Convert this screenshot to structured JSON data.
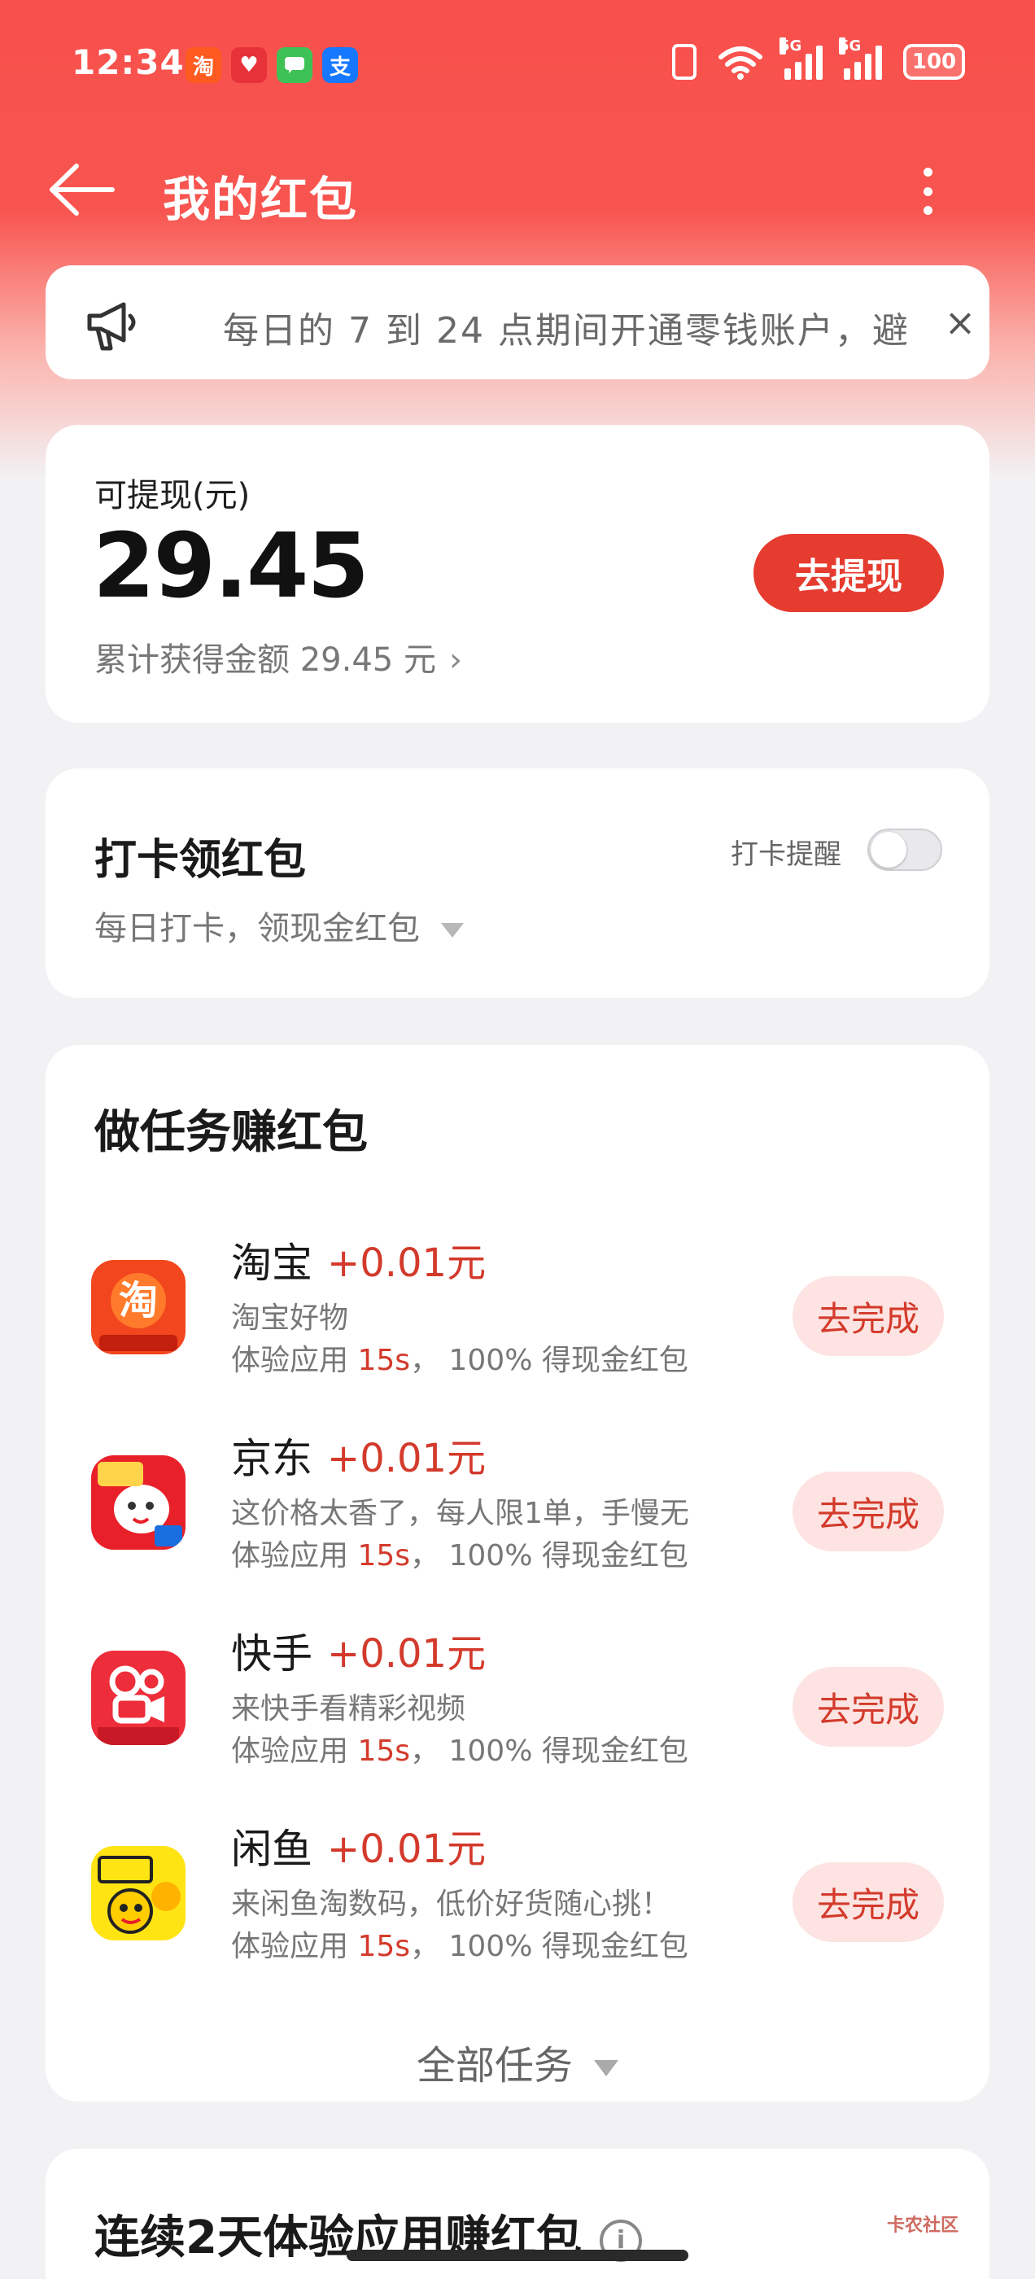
{
  "status_bar": {
    "time": "12:34",
    "battery": "100",
    "network_1": "5G",
    "network_2": "5G",
    "notifications": [
      {
        "icon": "taobao-notif-icon",
        "glyph": "淘",
        "color": "#ff5a1f"
      },
      {
        "icon": "heart-app-notif-icon",
        "glyph": "♥",
        "color": "#e8323a"
      },
      {
        "icon": "message-notif-icon",
        "glyph": "",
        "color": "#3ec256"
      },
      {
        "icon": "alipay-notif-icon",
        "glyph": "支",
        "color": "#1677ff"
      }
    ]
  },
  "header": {
    "title": "我的红包"
  },
  "notice": {
    "text": "每日的 7 到 24 点期间开通零钱账户，避",
    "close": "×"
  },
  "balance": {
    "label": "可提现(元)",
    "value": "29.45",
    "total_text": "累计获得金额 29.45 元",
    "withdraw_label": "去提现"
  },
  "checkin": {
    "title": "打卡领红包",
    "subtitle": "每日打卡，领现金红包",
    "remind_label": "打卡提醒",
    "remind_on": false
  },
  "tasks": {
    "heading": "做任务赚红包",
    "items": [
      {
        "name": "淘宝",
        "reward": "+0.01元",
        "desc": "淘宝好物",
        "meta_prefix": "体验应用",
        "meta_time": "15s",
        "meta_suffix": "，  100% 得现金红包",
        "button": "去完成",
        "icon": "taobao-app-icon"
      },
      {
        "name": "京东",
        "reward": "+0.01元",
        "desc": "这价格太香了，每人限1单，手慢无",
        "meta_prefix": "体验应用",
        "meta_time": "15s",
        "meta_suffix": "，  100% 得现金红包",
        "button": "去完成",
        "icon": "jd-app-icon"
      },
      {
        "name": "快手",
        "reward": "+0.01元",
        "desc": "来快手看精彩视频",
        "meta_prefix": "体验应用",
        "meta_time": "15s",
        "meta_suffix": "，  100% 得现金红包",
        "button": "去完成",
        "icon": "kuaishou-app-icon"
      },
      {
        "name": "闲鱼",
        "reward": "+0.01元",
        "desc": "来闲鱼淘数码，低价好货随心挑！",
        "meta_prefix": "体验应用",
        "meta_time": "15s",
        "meta_suffix": "，  100% 得现金红包",
        "button": "去完成",
        "icon": "xianyu-app-icon"
      }
    ],
    "all_label": "全部任务"
  },
  "streak": {
    "title": "连续2天体验应用赚红包"
  },
  "watermark": "卡农社区"
}
